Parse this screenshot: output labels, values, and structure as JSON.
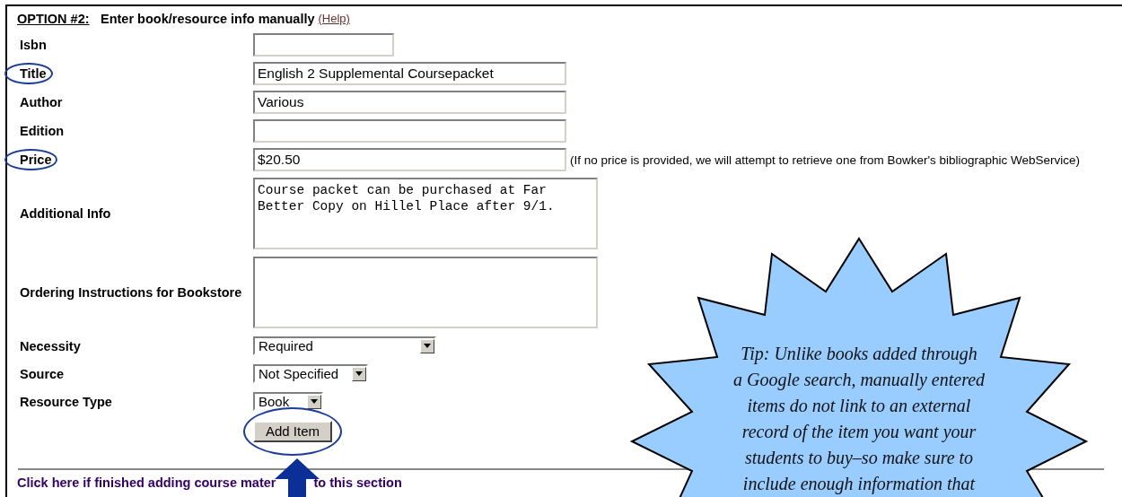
{
  "header": {
    "option_label": "OPTION #2:",
    "title": "Enter book/resource info manually",
    "help_link": "(Help)"
  },
  "fields": [
    {
      "kind": "text",
      "label": "Isbn",
      "circled": false
    },
    {
      "kind": "text",
      "label": "Title",
      "value": "English 2 Supplemental Coursepacket",
      "circled": true
    },
    {
      "kind": "text",
      "label": "Author",
      "value": "Various",
      "circled": false
    },
    {
      "kind": "text",
      "label": "Edition",
      "circled": false
    },
    {
      "kind": "text",
      "label": "Price",
      "value": "$20.50",
      "note": "(If no price is provided, we will attempt to retrieve one from Bowker's bibliographic WebService)",
      "circled": true
    },
    {
      "kind": "textarea",
      "label": "Additional Info",
      "value": "Course packet can be purchased at Far\nBetter Copy on Hillel Place after 9/1.",
      "circled": false
    },
    {
      "kind": "textarea",
      "label": "Ordering Instructions for Bookstore",
      "circled": false
    },
    {
      "kind": "select",
      "label": "Necessity",
      "value": "Required",
      "circled": false
    },
    {
      "kind": "select",
      "label": "Source",
      "value": "Not Specified",
      "circled": false
    },
    {
      "kind": "select",
      "label": "Resource Type",
      "value": "Book",
      "circled": false
    }
  ],
  "button": {
    "label": "Add Item",
    "circled": true
  },
  "finish_link": {
    "parts": [
      "Click here if finished adding course mater",
      "to this section"
    ]
  },
  "tip": {
    "lines": [
      "Tip: Unlike books added through",
      "a Google search, manually entered",
      "items do not link to an external",
      "record of the item you want your",
      "students to buy–so make sure to",
      "include enough information that"
    ]
  }
}
